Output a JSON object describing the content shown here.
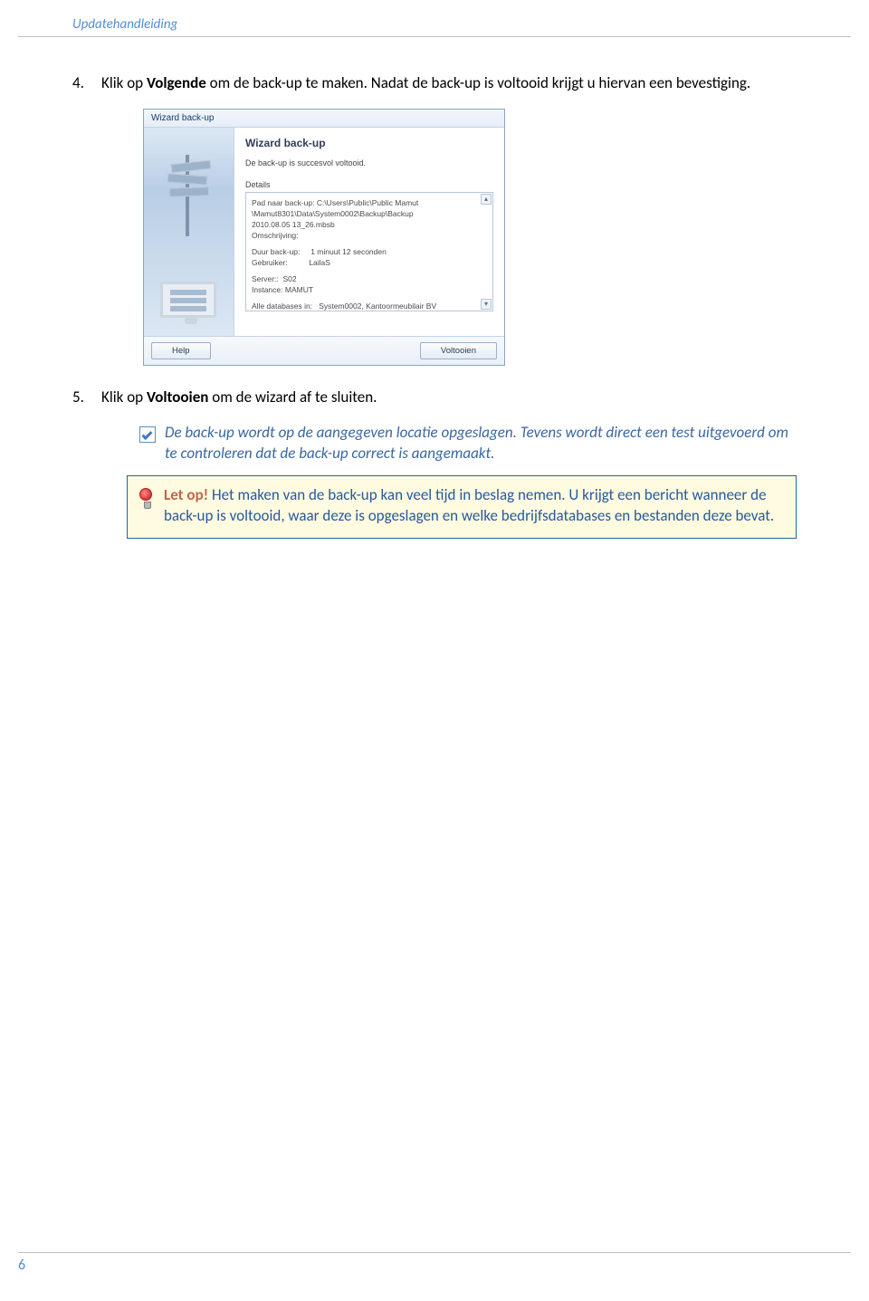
{
  "header": {
    "title": "Updatehandleiding"
  },
  "steps": {
    "s4": {
      "num": "4.",
      "pre": "Klik op ",
      "bold": "Volgende",
      "post": " om de back-up te maken. Nadat de back-up is voltooid krijgt u hiervan een bevestiging."
    },
    "s5": {
      "num": "5.",
      "pre": "Klik op ",
      "bold": "Voltooien",
      "post": " om de wizard af te sluiten."
    }
  },
  "wizard": {
    "title": "Wizard back-up",
    "heading": "Wizard back-up",
    "status": "De back-up is succesvol voltooid.",
    "details_label": "Details",
    "details": {
      "line1": "Pad naar back-up:  C:\\Users\\Public\\Public Mamut",
      "line2": "\\Mamut8301\\Data\\System0002\\Backup\\Backup",
      "line3": "2010.08.05 13_26.mbsb",
      "line4": "Omschrijving:",
      "dur_label": "Duur back-up:",
      "dur_val": "1 minuut 12 seconden",
      "user_label": "Gebruiker:",
      "user_val": "LailaS",
      "server_label": "Server::",
      "server_val": "S02",
      "inst_label": "Instance:",
      "inst_val": "MAMUT",
      "db_label": "Alle databases in:",
      "db_val": "System0002, Kantoormeubilair BV"
    },
    "buttons": {
      "help": "Help",
      "finish": "Voltooien"
    }
  },
  "tip": {
    "text": "De back-up wordt op de aangegeven locatie opgeslagen. Tevens wordt direct een test uitgevoerd om te controleren dat de back-up correct is aangemaakt."
  },
  "warn": {
    "lead": "Let op!",
    "text": " Het maken van de back-up kan veel tijd in beslag nemen. U krijgt een bericht wanneer de back-up is voltooid, waar deze is opgeslagen en welke bedrijfsdatabases en bestanden deze bevat."
  },
  "page_number": "6"
}
